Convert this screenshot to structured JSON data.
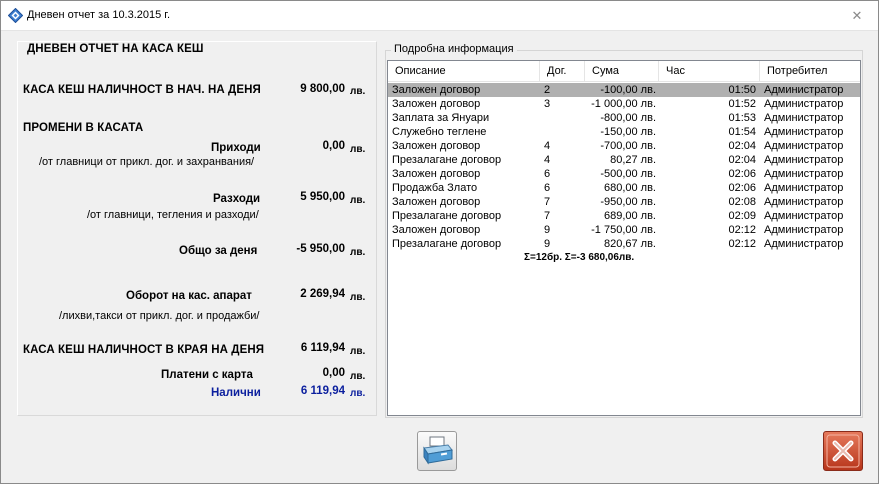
{
  "window": {
    "title": "Дневен отчет за 10.3.2015 г.",
    "close_glyph": "✕"
  },
  "left": {
    "heading": "ДНЕВЕН ОТЧЕТ НА КАСА КЕШ",
    "start_label": "КАСА КЕШ НАЛИЧНОСТ В НАЧ. НА ДЕНЯ",
    "start_amount": "9 800,00",
    "changes_heading": "ПРОМЕНИ В КАСАТА",
    "income_label": "Приходи",
    "income_amount": "0,00",
    "income_note": "/от главници от прикл. дог. и захранвания/",
    "expense_label": "Разходи",
    "expense_amount": "5 950,00",
    "expense_note": "/от главници, тегления и разходи/",
    "total_label": "Общо за деня",
    "total_amount": "-5 950,00",
    "turnover_label": "Оборот на кас. апарат",
    "turnover_amount": "2 269,94",
    "turnover_note": "/лихви,такси от прикл. дог. и продажби/",
    "end_label": "КАСА КЕШ НАЛИЧНОСТ В КРАЯ НА ДЕНЯ",
    "end_amount": "6 119,94",
    "card_label": "Платени с карта",
    "card_amount": "0,00",
    "cash_label": "Налични",
    "cash_amount": "6 119,94",
    "currency": "лв."
  },
  "details": {
    "group_title": "Подробна информация",
    "columns": [
      "Описание",
      "Дог.",
      "Сума",
      "Час",
      "Потребител"
    ],
    "rows": [
      {
        "desc": "Заложен договор",
        "dog": "2",
        "sum": "-100,00 лв.",
        "time": "01:50",
        "user": "Администратор"
      },
      {
        "desc": "Заложен договор",
        "dog": "3",
        "sum": "-1 000,00 лв.",
        "time": "01:52",
        "user": "Администратор"
      },
      {
        "desc": "Заплата за Януари",
        "dog": "",
        "sum": "-800,00 лв.",
        "time": "01:53",
        "user": "Администратор"
      },
      {
        "desc": "Служебно теглене",
        "dog": "",
        "sum": "-150,00 лв.",
        "time": "01:54",
        "user": "Администратор"
      },
      {
        "desc": "Заложен договор",
        "dog": "4",
        "sum": "-700,00 лв.",
        "time": "02:04",
        "user": "Администратор"
      },
      {
        "desc": "Презалагане договор",
        "dog": "4",
        "sum": "80,27 лв.",
        "time": "02:04",
        "user": "Администратор"
      },
      {
        "desc": "Заложен договор",
        "dog": "6",
        "sum": "-500,00 лв.",
        "time": "02:06",
        "user": "Администратор"
      },
      {
        "desc": "Продажба Злато",
        "dog": "6",
        "sum": "680,00 лв.",
        "time": "02:06",
        "user": "Администратор"
      },
      {
        "desc": "Заложен договор",
        "dog": "7",
        "sum": "-950,00 лв.",
        "time": "02:08",
        "user": "Администратор"
      },
      {
        "desc": "Презалагане договор",
        "dog": "7",
        "sum": "689,00 лв.",
        "time": "02:09",
        "user": "Администратор"
      },
      {
        "desc": "Заложен договор",
        "dog": "9",
        "sum": "-1 750,00 лв.",
        "time": "02:12",
        "user": "Администратор"
      },
      {
        "desc": "Презалагане договор",
        "dog": "9",
        "sum": "820,67 лв.",
        "time": "02:12",
        "user": "Администратор"
      }
    ],
    "total": "Σ=12бр.   Σ=-3 680,06лв."
  },
  "buttons": {
    "print_icon": "printer-icon",
    "close_icon": "close-icon"
  },
  "colors": {
    "accent_blue": "#0b1f9e",
    "selected_row": "#b0b0b0",
    "close_button": "#c0401f"
  }
}
